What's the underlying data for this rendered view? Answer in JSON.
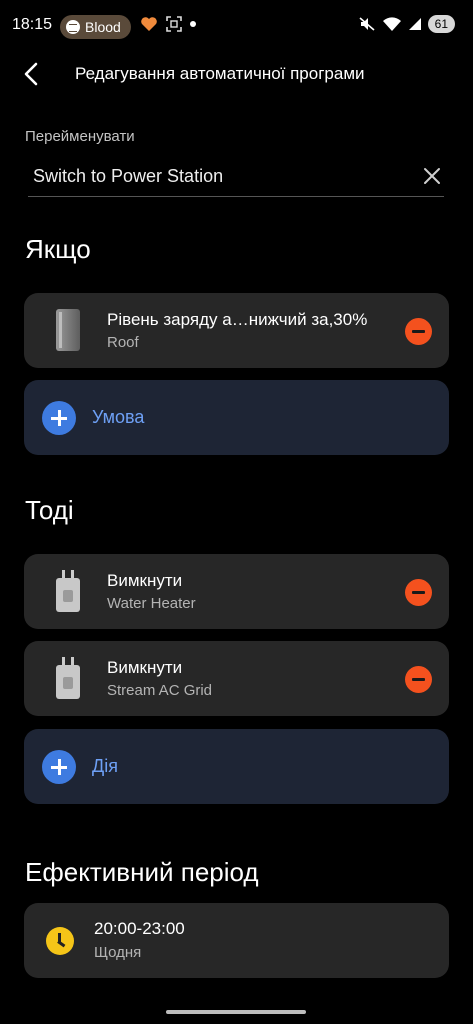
{
  "status_bar": {
    "time": "18:15",
    "pill_label": "Blood",
    "battery": "61"
  },
  "header": {
    "title": "Редагування автоматичної програми"
  },
  "rename": {
    "label": "Перейменувати",
    "value": "Switch to Power Station"
  },
  "if_section": {
    "title": "Якщо",
    "conditions": [
      {
        "title": "Рівень заряду а…нижчий за,30%",
        "subtitle": "Roof"
      }
    ],
    "add_label": "Умова"
  },
  "then_section": {
    "title": "Тоді",
    "actions": [
      {
        "title": "Вимкнути",
        "subtitle": "Water Heater"
      },
      {
        "title": "Вимкнути",
        "subtitle": "Stream AC Grid"
      }
    ],
    "add_label": "Дія"
  },
  "period_section": {
    "title": "Ефективний період",
    "time": "20:00-23:00",
    "repeat": "Щодня"
  },
  "colors": {
    "accent": "#3e7be0",
    "remove": "#f4511e",
    "clock": "#f5c518",
    "card": "#272727"
  }
}
